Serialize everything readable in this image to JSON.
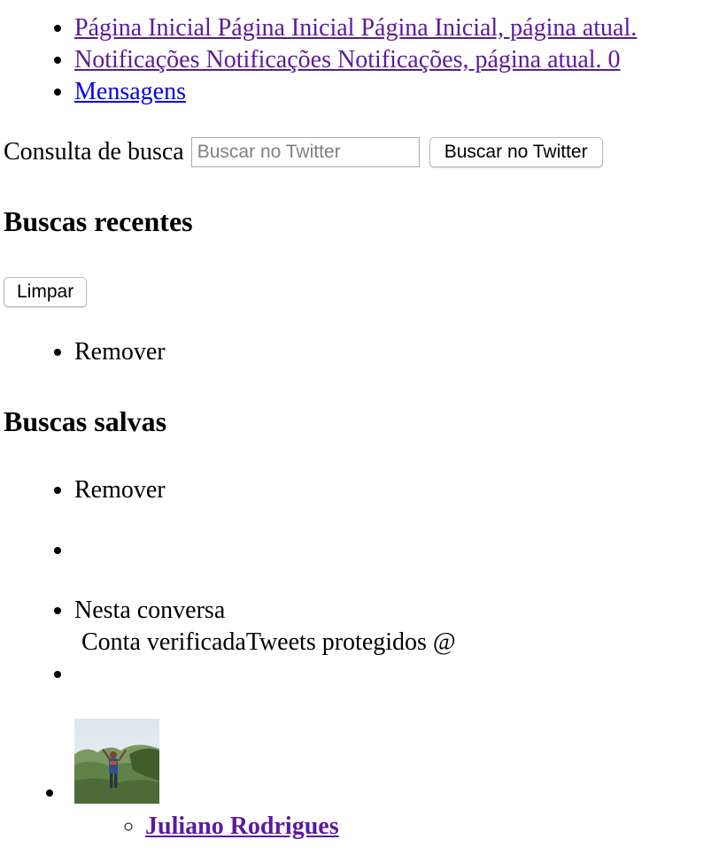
{
  "nav": {
    "items": [
      {
        "label": "Página Inicial Página Inicial Página Inicial, página atual."
      },
      {
        "label": "Notificações Notificações Notificações, página atual. 0"
      },
      {
        "label": "Mensagens"
      }
    ]
  },
  "search": {
    "label": "Consulta de busca",
    "placeholder": "Buscar no Twitter",
    "button_label": "Buscar no Twitter"
  },
  "recent": {
    "heading": "Buscas recentes",
    "clear_label": "Limpar",
    "items": [
      {
        "label": "Remover"
      }
    ]
  },
  "saved": {
    "heading": "Buscas salvas",
    "items": [
      {
        "label": "Remover"
      }
    ]
  },
  "conversation": {
    "title": "Nesta conversa",
    "verified_label": "Conta verificada",
    "protected_label": "Tweets protegidos",
    "at_sign": "@"
  },
  "user": {
    "name": "Juliano Rodrigues",
    "avatar_icon": "profile-photo-icon"
  }
}
